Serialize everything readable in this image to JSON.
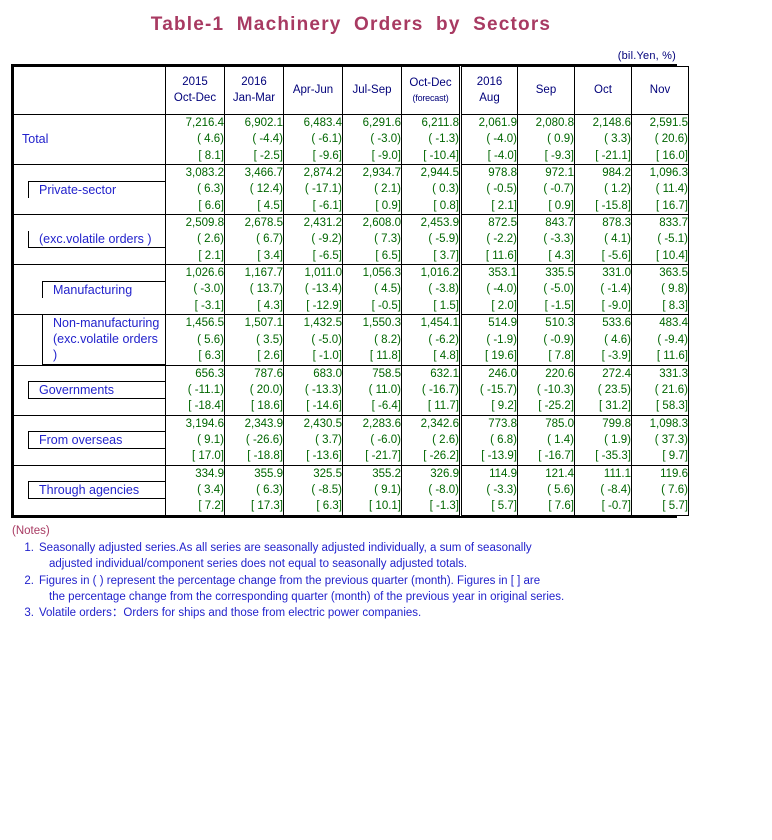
{
  "title": "Table-1  Machinery  Orders  by  Sectors",
  "unit_caption": "(bil.Yen, %)",
  "colors": {
    "title": "#a83a62",
    "label_text": "#2222cc",
    "value_text": "#006600",
    "header_text": "#00007a",
    "notes_text": "#2222cc",
    "notes_head": "#a83a62"
  },
  "header": {
    "corner": "",
    "columns": [
      {
        "year": "2015",
        "period": "Oct-Dec",
        "note": ""
      },
      {
        "year": "2016",
        "period": "Jan-Mar",
        "note": ""
      },
      {
        "year": "",
        "period": "Apr-Jun",
        "note": ""
      },
      {
        "year": "",
        "period": "Jul-Sep",
        "note": ""
      },
      {
        "year": "",
        "period": "Oct-Dec",
        "note": "(forecast)"
      },
      {
        "year": "2016",
        "period": "Aug",
        "note": ""
      },
      {
        "year": "",
        "period": "Sep",
        "note": ""
      },
      {
        "year": "",
        "period": "Oct",
        "note": ""
      },
      {
        "year": "",
        "period": "Nov",
        "note": ""
      }
    ]
  },
  "rows": [
    {
      "label": "Total",
      "label2": "",
      "level": 0,
      "level_values": [
        "7,216.4",
        "6,902.1",
        "6,483.4",
        "6,291.6",
        "6,211.8",
        "2,061.9",
        "2,080.8",
        "2,148.6",
        "2,591.5"
      ],
      "prev_period_pct": [
        "( 4.6)",
        "( -4.4)",
        "( -6.1)",
        "( -3.0)",
        "( -1.3)",
        "( -4.0)",
        "( 0.9)",
        "( 3.3)",
        "( 20.6)"
      ],
      "prev_year_pct": [
        "[ 8.1]",
        "[ -2.5]",
        "[ -9.6]",
        "[ -9.0]",
        "[ -10.4]",
        "[ -4.0]",
        "[ -9.3]",
        "[ -21.1]",
        "[ 16.0]"
      ]
    },
    {
      "label": "Private-sector",
      "label2": "",
      "level": 1,
      "level_values": [
        "3,083.2",
        "3,466.7",
        "2,874.2",
        "2,934.7",
        "2,944.5",
        "978.8",
        "972.1",
        "984.2",
        "1,096.3"
      ],
      "prev_period_pct": [
        "( 6.3)",
        "( 12.4)",
        "( -17.1)",
        "( 2.1)",
        "( 0.3)",
        "( -0.5)",
        "( -0.7)",
        "( 1.2)",
        "( 11.4)"
      ],
      "prev_year_pct": [
        "[ 6.6]",
        "[ 4.5]",
        "[ -6.1]",
        "[ 0.9]",
        "[ 0.8]",
        "[ 2.1]",
        "[ 0.9]",
        "[ -15.8]",
        "[ 16.7]"
      ]
    },
    {
      "label": "(exc.volatile orders )",
      "label2": "",
      "level": 1,
      "level_values": [
        "2,509.8",
        "2,678.5",
        "2,431.2",
        "2,608.0",
        "2,453.9",
        "872.5",
        "843.7",
        "878.3",
        "833.7"
      ],
      "prev_period_pct": [
        "( 2.6)",
        "( 6.7)",
        "( -9.2)",
        "( 7.3)",
        "( -5.9)",
        "( -2.2)",
        "( -3.3)",
        "( 4.1)",
        "( -5.1)"
      ],
      "prev_year_pct": [
        "[ 2.1]",
        "[ 3.4]",
        "[ -6.5]",
        "[ 6.5]",
        "[ 3.7]",
        "[ 11.6]",
        "[ 4.3]",
        "[ -5.6]",
        "[ 10.4]"
      ]
    },
    {
      "label": "Manufacturing",
      "label2": "",
      "level": 2,
      "level_values": [
        "1,026.6",
        "1,167.7",
        "1,011.0",
        "1,056.3",
        "1,016.2",
        "353.1",
        "335.5",
        "331.0",
        "363.5"
      ],
      "prev_period_pct": [
        "( -3.0)",
        "( 13.7)",
        "( -13.4)",
        "( 4.5)",
        "( -3.8)",
        "( -4.0)",
        "( -5.0)",
        "( -1.4)",
        "( 9.8)"
      ],
      "prev_year_pct": [
        "[ -3.1]",
        "[ 4.3]",
        "[ -12.9]",
        "[ -0.5]",
        "[ 1.5]",
        "[ 2.0]",
        "[ -1.5]",
        "[ -9.0]",
        "[ 8.3]"
      ]
    },
    {
      "label": "Non-manufacturing",
      "label2": "(exc.volatile orders )",
      "level": 2,
      "level_values": [
        "1,456.5",
        "1,507.1",
        "1,432.5",
        "1,550.3",
        "1,454.1",
        "514.9",
        "510.3",
        "533.6",
        "483.4"
      ],
      "prev_period_pct": [
        "( 5.6)",
        "( 3.5)",
        "( -5.0)",
        "( 8.2)",
        "( -6.2)",
        "( -1.9)",
        "( -0.9)",
        "( 4.6)",
        "( -9.4)"
      ],
      "prev_year_pct": [
        "[ 6.3]",
        "[ 2.6]",
        "[ -1.0]",
        "[ 11.8]",
        "[ 4.8]",
        "[ 19.6]",
        "[ 7.8]",
        "[ -3.9]",
        "[ 11.6]"
      ]
    },
    {
      "label": "Governments",
      "label2": "",
      "level": 1,
      "level_values": [
        "656.3",
        "787.6",
        "683.0",
        "758.5",
        "632.1",
        "246.0",
        "220.6",
        "272.4",
        "331.3"
      ],
      "prev_period_pct": [
        "( -11.1)",
        "( 20.0)",
        "( -13.3)",
        "( 11.0)",
        "( -16.7)",
        "( -15.7)",
        "( -10.3)",
        "( 23.5)",
        "( 21.6)"
      ],
      "prev_year_pct": [
        "[ -18.4]",
        "[ 18.6]",
        "[ -14.6]",
        "[ -6.4]",
        "[ 11.7]",
        "[ 9.2]",
        "[ -25.2]",
        "[ 31.2]",
        "[ 58.3]"
      ]
    },
    {
      "label": "From overseas",
      "label2": "",
      "level": 1,
      "level_values": [
        "3,194.6",
        "2,343.9",
        "2,430.5",
        "2,283.6",
        "2,342.6",
        "773.8",
        "785.0",
        "799.8",
        "1,098.3"
      ],
      "prev_period_pct": [
        "( 9.1)",
        "( -26.6)",
        "( 3.7)",
        "( -6.0)",
        "( 2.6)",
        "( 6.8)",
        "( 1.4)",
        "( 1.9)",
        "( 37.3)"
      ],
      "prev_year_pct": [
        "[ 17.0]",
        "[ -18.8]",
        "[ -13.6]",
        "[ -21.7]",
        "[ -26.2]",
        "[ -13.9]",
        "[ -16.7]",
        "[ -35.3]",
        "[ 9.7]"
      ]
    },
    {
      "label": "Through agencies",
      "label2": "",
      "level": 1,
      "level_values": [
        "334.9",
        "355.9",
        "325.5",
        "355.2",
        "326.9",
        "114.9",
        "121.4",
        "111.1",
        "119.6"
      ],
      "prev_period_pct": [
        "( 3.4)",
        "( 6.3)",
        "( -8.5)",
        "( 9.1)",
        "( -8.0)",
        "( -3.3)",
        "( 5.6)",
        "( -8.4)",
        "( 7.6)"
      ],
      "prev_year_pct": [
        "[ 7.2]",
        "[ 17.3]",
        "[ 6.3]",
        "[ 10.1]",
        "[ -1.3]",
        "[ 5.7]",
        "[ 7.6]",
        "[ -0.7]",
        "[ 5.7]"
      ]
    }
  ],
  "notes": {
    "heading": "(Notes)",
    "items": [
      {
        "num": "1.",
        "line1": "Seasonally adjusted series.As all series are seasonally adjusted individually, a sum of seasonally",
        "line2": "adjusted individual/component series does not equal to seasonally adjusted totals."
      },
      {
        "num": "2.",
        "line1": "Figures in ( ) represent the percentage change from the previous quarter (month). Figures in [ ] are",
        "line2": "the percentage change from the corresponding quarter (month) of the previous year in original series."
      },
      {
        "num": "3.",
        "line1": "Volatile orders：Orders for ships and those from electric power companies.",
        "line2": ""
      }
    ]
  },
  "chart_data": {
    "type": "table",
    "title": "Table-1  Machinery  Orders  by  Sectors",
    "units": "(bil.Yen, %)",
    "categories": [
      "2015 Oct-Dec",
      "2016 Jan-Mar",
      "2016 Apr-Jun",
      "2016 Jul-Sep",
      "2016 Oct-Dec (forecast)",
      "2016 Aug",
      "2016 Sep",
      "2016 Oct",
      "2016 Nov"
    ],
    "series": [
      {
        "name": "Total",
        "values": [
          7216.4,
          6902.1,
          6483.4,
          6291.6,
          6211.8,
          2061.9,
          2080.8,
          2148.6,
          2591.5
        ]
      },
      {
        "name": "Private-sector",
        "values": [
          3083.2,
          3466.7,
          2874.2,
          2934.7,
          2944.5,
          978.8,
          972.1,
          984.2,
          1096.3
        ]
      },
      {
        "name": "Private-sector (exc.volatile orders)",
        "values": [
          2509.8,
          2678.5,
          2431.2,
          2608.0,
          2453.9,
          872.5,
          843.7,
          878.3,
          833.7
        ]
      },
      {
        "name": "Manufacturing",
        "values": [
          1026.6,
          1167.7,
          1011.0,
          1056.3,
          1016.2,
          353.1,
          335.5,
          331.0,
          363.5
        ]
      },
      {
        "name": "Non-manufacturing (exc.volatile orders)",
        "values": [
          1456.5,
          1507.1,
          1432.5,
          1550.3,
          1454.1,
          514.9,
          510.3,
          533.6,
          483.4
        ]
      },
      {
        "name": "Governments",
        "values": [
          656.3,
          787.6,
          683.0,
          758.5,
          632.1,
          246.0,
          220.6,
          272.4,
          331.3
        ]
      },
      {
        "name": "From overseas",
        "values": [
          3194.6,
          2343.9,
          2430.5,
          2283.6,
          2342.6,
          773.8,
          785.0,
          799.8,
          1098.3
        ]
      },
      {
        "name": "Through agencies",
        "values": [
          334.9,
          355.9,
          325.5,
          355.2,
          326.9,
          114.9,
          121.4,
          111.1,
          119.6
        ]
      }
    ],
    "pct_change_prev_period": [
      {
        "name": "Total",
        "values": [
          4.6,
          -4.4,
          -6.1,
          -3.0,
          -1.3,
          -4.0,
          0.9,
          3.3,
          20.6
        ]
      },
      {
        "name": "Private-sector",
        "values": [
          6.3,
          12.4,
          -17.1,
          2.1,
          0.3,
          -0.5,
          -0.7,
          1.2,
          11.4
        ]
      },
      {
        "name": "Private-sector (exc.volatile orders)",
        "values": [
          2.6,
          6.7,
          -9.2,
          7.3,
          -5.9,
          -2.2,
          -3.3,
          4.1,
          -5.1
        ]
      },
      {
        "name": "Manufacturing",
        "values": [
          -3.0,
          13.7,
          -13.4,
          4.5,
          -3.8,
          -4.0,
          -5.0,
          -1.4,
          9.8
        ]
      },
      {
        "name": "Non-manufacturing (exc.volatile orders)",
        "values": [
          5.6,
          3.5,
          -5.0,
          8.2,
          -6.2,
          -1.9,
          -0.9,
          4.6,
          -9.4
        ]
      },
      {
        "name": "Governments",
        "values": [
          -11.1,
          20.0,
          -13.3,
          11.0,
          -16.7,
          -15.7,
          -10.3,
          23.5,
          21.6
        ]
      },
      {
        "name": "From overseas",
        "values": [
          9.1,
          -26.6,
          3.7,
          -6.0,
          2.6,
          6.8,
          1.4,
          1.9,
          37.3
        ]
      },
      {
        "name": "Through agencies",
        "values": [
          3.4,
          6.3,
          -8.5,
          9.1,
          -8.0,
          -3.3,
          5.6,
          -8.4,
          7.6
        ]
      }
    ],
    "pct_change_prev_year": [
      {
        "name": "Total",
        "values": [
          8.1,
          -2.5,
          -9.6,
          -9.0,
          -10.4,
          -4.0,
          -9.3,
          -21.1,
          16.0
        ]
      },
      {
        "name": "Private-sector",
        "values": [
          6.6,
          4.5,
          -6.1,
          0.9,
          0.8,
          2.1,
          0.9,
          -15.8,
          16.7
        ]
      },
      {
        "name": "Private-sector (exc.volatile orders)",
        "values": [
          2.1,
          3.4,
          -6.5,
          6.5,
          3.7,
          11.6,
          4.3,
          -5.6,
          10.4
        ]
      },
      {
        "name": "Manufacturing",
        "values": [
          -3.1,
          4.3,
          -12.9,
          -0.5,
          1.5,
          2.0,
          -1.5,
          -9.0,
          8.3
        ]
      },
      {
        "name": "Non-manufacturing (exc.volatile orders)",
        "values": [
          6.3,
          2.6,
          -1.0,
          11.8,
          4.8,
          19.6,
          7.8,
          -3.9,
          11.6
        ]
      },
      {
        "name": "Governments",
        "values": [
          -18.4,
          18.6,
          -14.6,
          -6.4,
          11.7,
          9.2,
          -25.2,
          31.2,
          58.3
        ]
      },
      {
        "name": "From overseas",
        "values": [
          17.0,
          -18.8,
          -13.6,
          -21.7,
          -26.2,
          -13.9,
          -16.7,
          -35.3,
          9.7
        ]
      },
      {
        "name": "Through agencies",
        "values": [
          7.2,
          17.3,
          6.3,
          10.1,
          -1.3,
          5.7,
          7.6,
          -0.7,
          5.7
        ]
      }
    ]
  }
}
